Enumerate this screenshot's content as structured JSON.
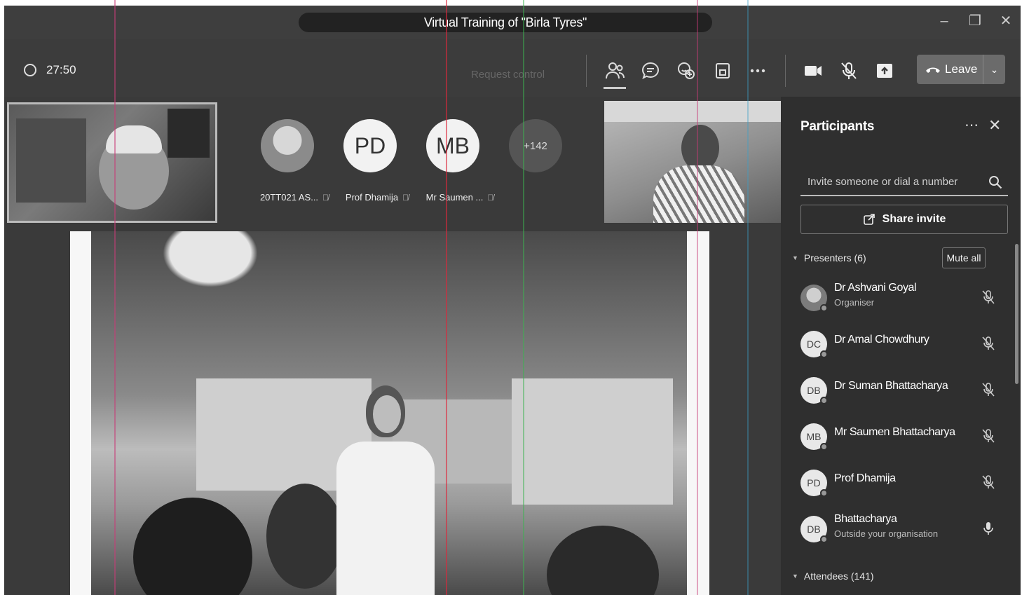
{
  "window": {
    "title": "Virtual Training of \"Birla Tyres\"",
    "controls": [
      "minimize",
      "restore",
      "close"
    ]
  },
  "toolbar": {
    "timer": "27:50",
    "request_control": "Request control",
    "leave_label": "Leave"
  },
  "tiles": [
    {
      "name": "20TT021 AS...",
      "initials": "",
      "photo": true,
      "muted": true
    },
    {
      "name": "Prof Dhamija",
      "initials": "PD",
      "photo": false,
      "muted": true
    },
    {
      "name": "Mr Saumen ...",
      "initials": "MB",
      "photo": false,
      "muted": true
    },
    {
      "name": "",
      "initials": "+142",
      "photo": false,
      "muted": false
    }
  ],
  "panel": {
    "title": "Participants",
    "invite_placeholder": "Invite someone or dial a number",
    "share_invite": "Share invite",
    "presenters_heading": "Presenters (6)",
    "mute_all": "Mute all",
    "attendees_heading": "Attendees (141)",
    "presenters": [
      {
        "initials": "",
        "photo": true,
        "name": "Dr Ashvani Goyal",
        "sub": "Organiser",
        "mic": "muted"
      },
      {
        "initials": "DC",
        "photo": false,
        "name": "Dr Amal Chowdhury",
        "sub": "",
        "mic": "muted"
      },
      {
        "initials": "DB",
        "photo": false,
        "name": "Dr Suman Bhattacharya",
        "sub": "",
        "mic": "muted"
      },
      {
        "initials": "MB",
        "photo": false,
        "name": "Mr Saumen Bhattacharya",
        "sub": "",
        "mic": "muted"
      },
      {
        "initials": "PD",
        "photo": false,
        "name": "Prof Dhamija",
        "sub": "",
        "mic": "muted"
      },
      {
        "initials": "DB",
        "photo": false,
        "name": "Bhattacharya",
        "sub": "Outside your organisation",
        "mic": "on"
      }
    ]
  },
  "colors": {
    "window_bg": "#3a3a3a",
    "panel_bg": "#2f2f2f",
    "accent_text": "#ffffff"
  }
}
